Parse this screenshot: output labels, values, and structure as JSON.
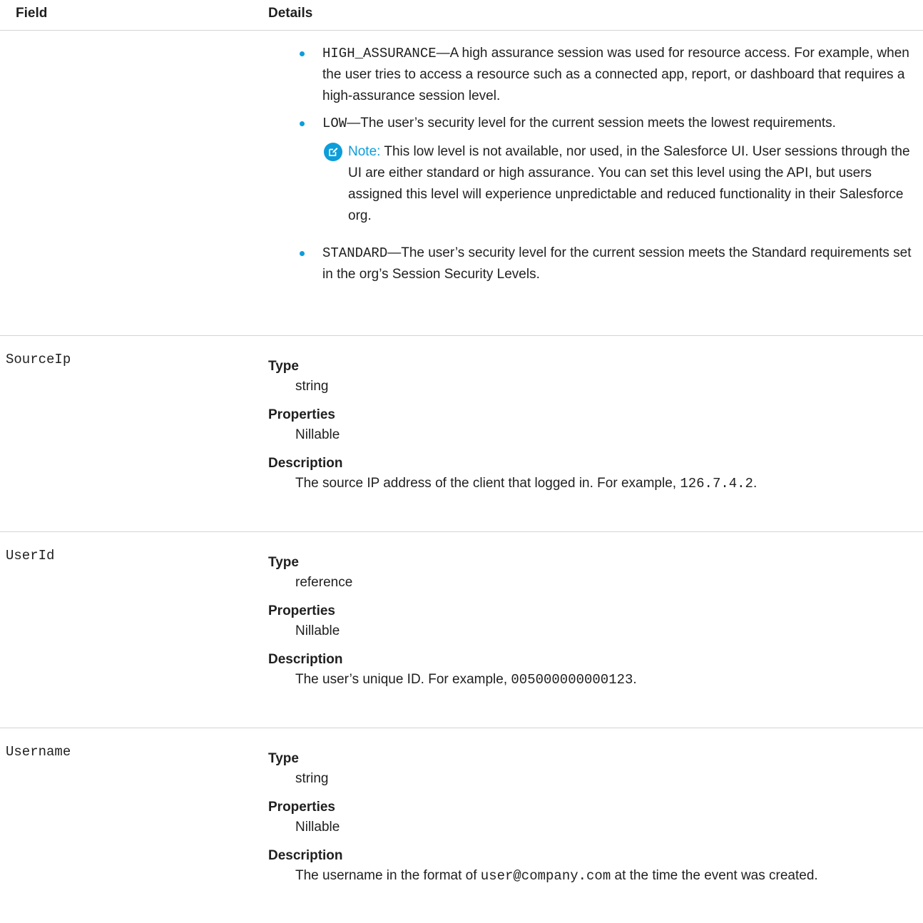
{
  "header": {
    "field": "Field",
    "details": "Details"
  },
  "session_levels": {
    "high_assurance_code": "HIGH_ASSURANCE",
    "high_assurance_text": "—A high assurance session was used for resource access. For example, when the user tries to access a resource such as a connected app, report, or dashboard that requires a high-assurance session level.",
    "low_code": "LOW",
    "low_text": "—The user’s security level for the current session meets the lowest requirements.",
    "note_label": "Note:",
    "note_text": "This low level is not available, nor used, in the Salesforce UI. User sessions through the UI are either standard or high assurance. You can set this level using the API, but users assigned this level will experience unpredictable and reduced functionality in their Salesforce org.",
    "standard_code": "STANDARD",
    "standard_text": "—The user’s security level for the current session meets the Standard requirements set in the org’s Session Security Levels."
  },
  "labels": {
    "type": "Type",
    "properties": "Properties",
    "description": "Description"
  },
  "fields": [
    {
      "name": "SourceIp",
      "type": "string",
      "properties": "Nillable",
      "desc_pre": "The source IP address of the client that logged in. For example, ",
      "desc_code": "126.7.4.2",
      "desc_post": "."
    },
    {
      "name": "UserId",
      "type": "reference",
      "properties": "Nillable",
      "desc_pre": "The user’s unique ID. For example, ",
      "desc_code": "005000000000123",
      "desc_post": "."
    },
    {
      "name": "Username",
      "type": "string",
      "properties": "Nillable",
      "desc_pre": "The username in the format of ",
      "desc_code": "user@company.com",
      "desc_post": " at the time the event was created."
    }
  ]
}
